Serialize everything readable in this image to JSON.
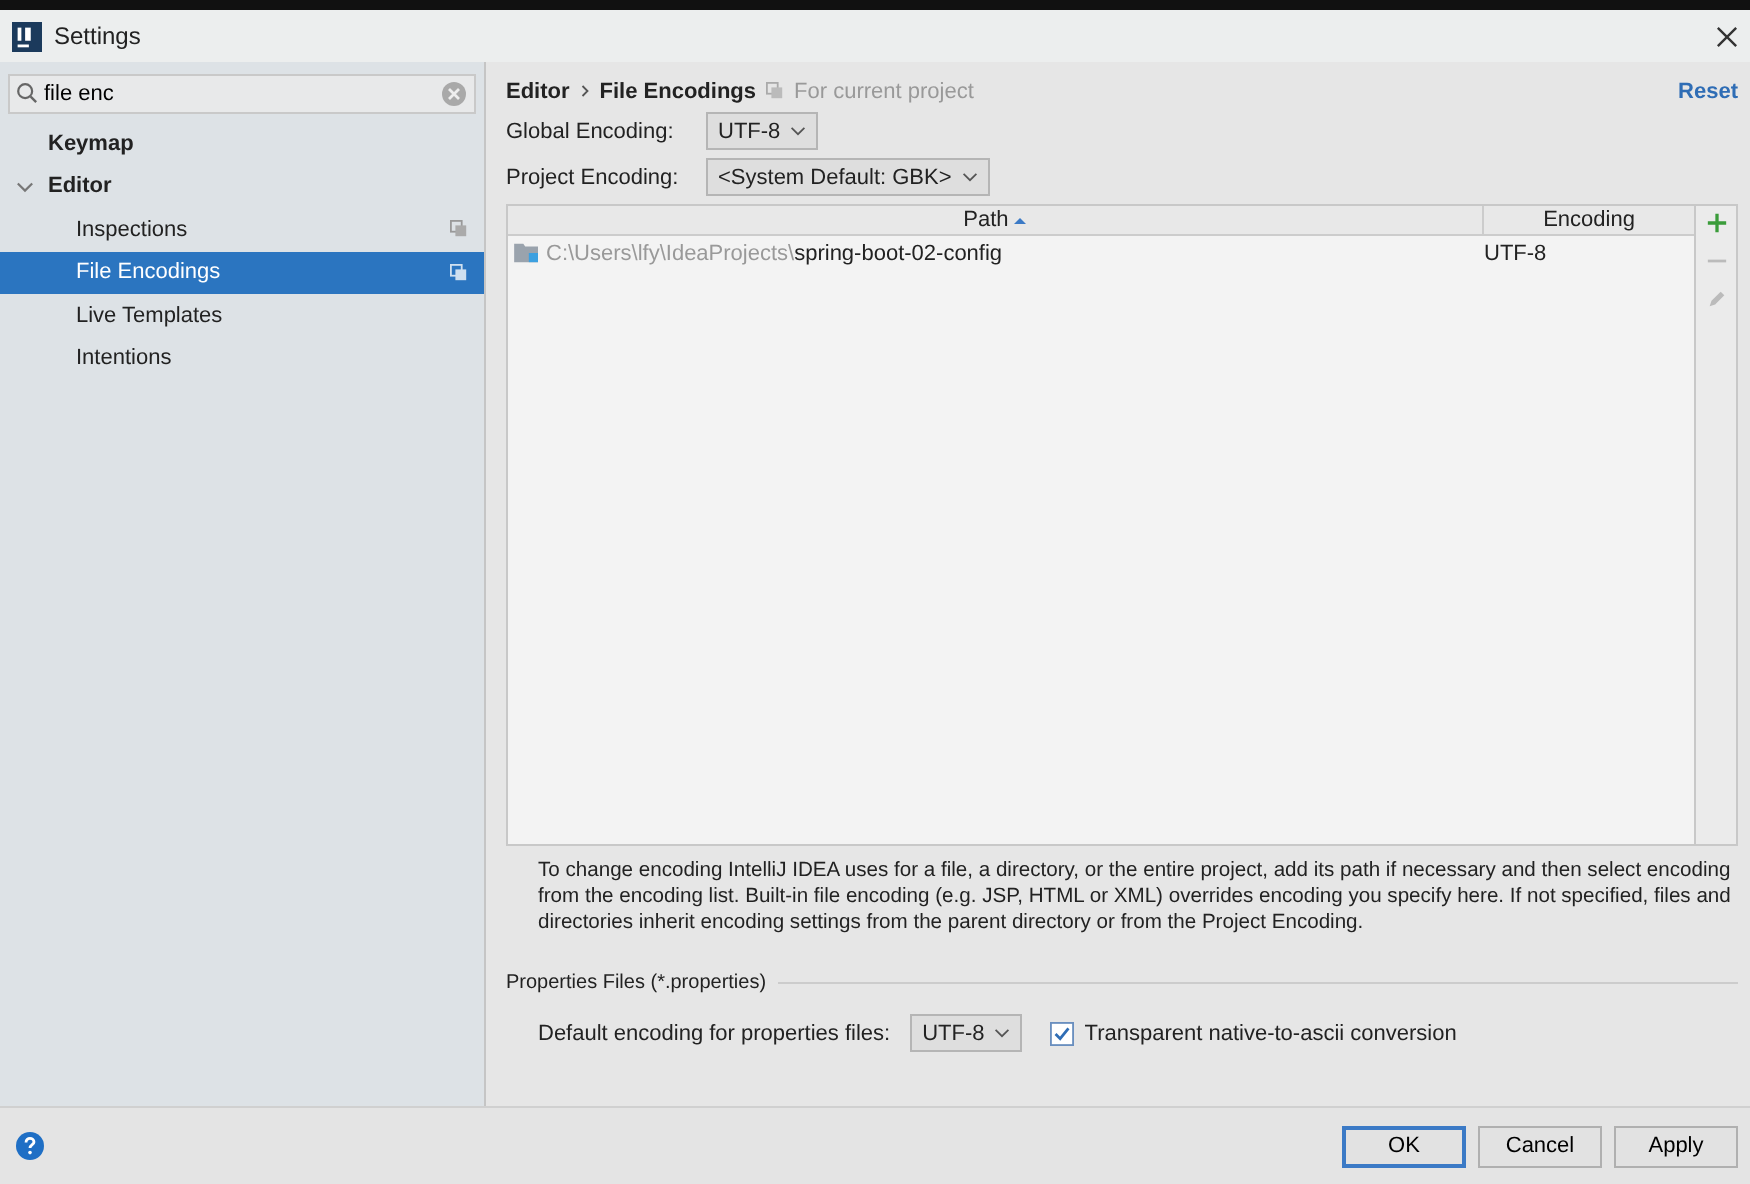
{
  "window": {
    "title": "Settings"
  },
  "search": {
    "value": "file enc"
  },
  "sidebar": {
    "items": [
      {
        "label": "Keymap",
        "selected": false,
        "project_scoped": false
      },
      {
        "label": "Editor",
        "expanded": true,
        "selected": false,
        "project_scoped": false,
        "children": [
          {
            "label": "Inspections",
            "selected": false,
            "project_scoped": true
          },
          {
            "label": "File Encodings",
            "selected": true,
            "project_scoped": true
          },
          {
            "label": "Live Templates",
            "selected": false,
            "project_scoped": false
          },
          {
            "label": "Intentions",
            "selected": false,
            "project_scoped": false
          }
        ]
      }
    ]
  },
  "breadcrumb": [
    "Editor",
    "File Encodings"
  ],
  "scope_note": "For current project",
  "reset_link": "Reset",
  "global_encoding": {
    "label": "Global Encoding:",
    "value": "UTF-8"
  },
  "project_encoding": {
    "label": "Project Encoding:",
    "value": "<System Default: GBK>"
  },
  "table": {
    "columns": [
      {
        "label": "Path",
        "sorted": true
      },
      {
        "label": "Encoding",
        "sorted": false
      }
    ],
    "rows": [
      {
        "path_dir": "C:\\Users\\lfy\\IdeaProjects\\",
        "path_name": "spring-boot-02-config",
        "encoding": "UTF-8"
      }
    ]
  },
  "description": "To change encoding IntelliJ IDEA uses for a file, a directory, or the entire project, add its path if necessary and then select encoding from the encoding list. Built-in file encoding (e.g. JSP, HTML or XML) overrides encoding you specify here. If not specified, files and directories inherit encoding settings from the parent directory or from the Project Encoding.",
  "properties": {
    "title": "Properties Files (*.properties)",
    "label": "Default encoding for properties files:",
    "value": "UTF-8",
    "checkbox": {
      "label": "Transparent native-to-ascii conversion",
      "checked": true
    }
  },
  "buttons": [
    {
      "label": "OK",
      "default": true
    },
    {
      "label": "Cancel",
      "default": false
    },
    {
      "label": "Apply",
      "default": false
    }
  ]
}
